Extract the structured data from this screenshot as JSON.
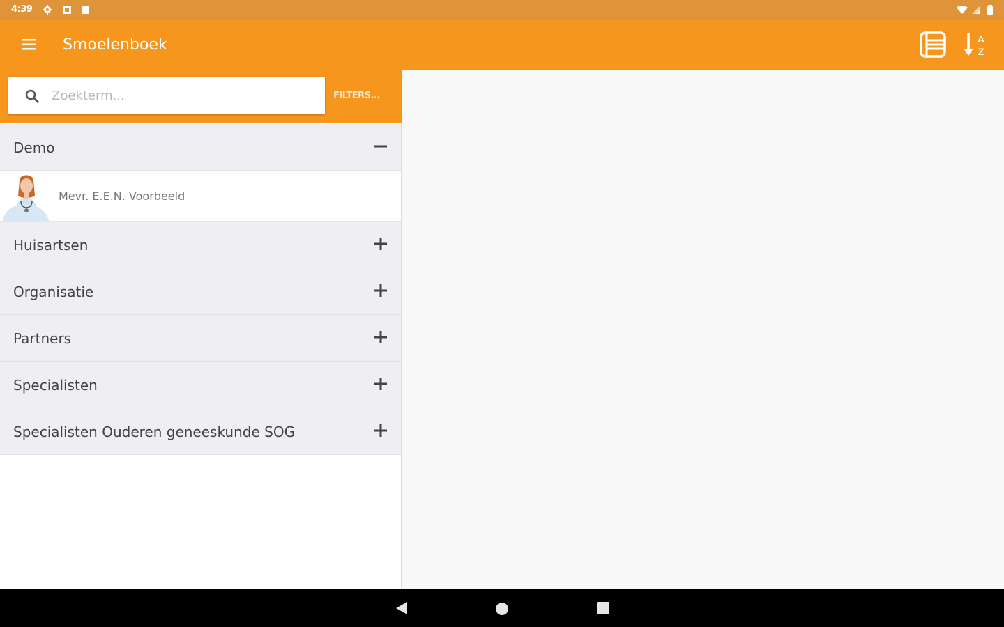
{
  "status_bar": {
    "time": "4:39",
    "icons": [
      "settings-icon",
      "notification-icon",
      "sd-card-icon",
      "wifi-icon",
      "signal-icon",
      "battery-icon"
    ]
  },
  "app_bar": {
    "title": "Smoelenboek",
    "menu_icon": "hamburger-menu-icon",
    "actions": [
      "list-view-icon",
      "sort-az-icon"
    ],
    "sort_glyph_top": "A",
    "sort_glyph_bottom": "Z"
  },
  "search": {
    "placeholder": "Zoekterm...",
    "value": "",
    "filters_label": "FILTERS..."
  },
  "groups": [
    {
      "label": "Demo",
      "expanded": true,
      "toggle": "−",
      "members": [
        {
          "name": "Mevr. E.E.N. Voorbeeld"
        }
      ]
    },
    {
      "label": "Huisartsen",
      "expanded": false,
      "toggle": "+"
    },
    {
      "label": "Organisatie",
      "expanded": false,
      "toggle": "+"
    },
    {
      "label": "Partners",
      "expanded": false,
      "toggle": "+"
    },
    {
      "label": "Specialisten",
      "expanded": false,
      "toggle": "+"
    },
    {
      "label": "Specialisten Ouderen geneeskunde SOG",
      "expanded": false,
      "toggle": "+"
    }
  ],
  "nav_bar": {
    "icons": [
      "back-icon",
      "home-icon",
      "recents-icon"
    ]
  },
  "colors": {
    "status_bar": "#e0943a",
    "app_bar": "#f7961d",
    "group_bg": "#efeff3",
    "detail_bg": "#f8f8f9",
    "nav_bar": "#000000"
  }
}
